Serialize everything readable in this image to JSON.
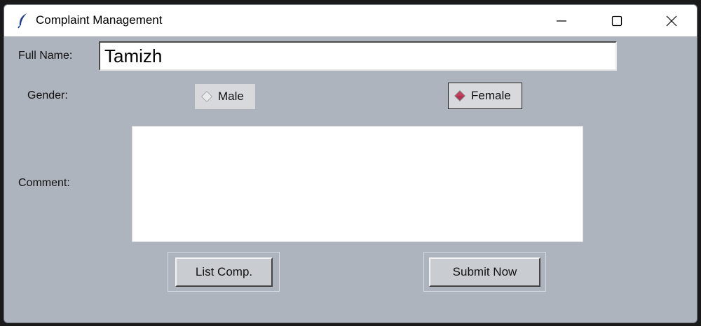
{
  "window": {
    "title": "Complaint Management",
    "icons": {
      "app": "feather-icon",
      "minimize": "minimize-icon",
      "maximize": "maximize-icon",
      "close": "close-icon"
    }
  },
  "form": {
    "full_name_label": "Full Name:",
    "full_name_value": "Tamizh",
    "gender_label": "Gender:",
    "gender_options": [
      "Male",
      "Female"
    ],
    "gender_selected": "Female",
    "comment_label": "Comment:",
    "comment_value": ""
  },
  "buttons": {
    "list_label": "List Comp.",
    "submit_label": "Submit Now"
  },
  "colors": {
    "background": "#aeb4bd",
    "radio_selected": "#b5304f"
  }
}
